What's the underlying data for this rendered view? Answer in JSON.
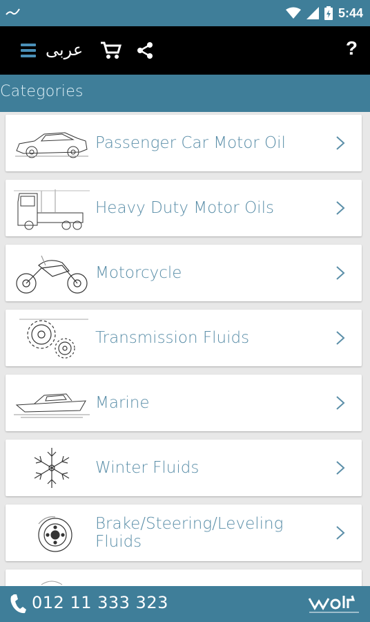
{
  "status_bar": {
    "time": "5:44"
  },
  "toolbar": {
    "language_label": "عربى",
    "help_label": "?"
  },
  "header": {
    "title": "Categories"
  },
  "categories": [
    {
      "label": "Passenger Car Motor Oil",
      "icon": "car-icon"
    },
    {
      "label": "Heavy Duty Motor Oils",
      "icon": "truck-icon"
    },
    {
      "label": "Motorcycle",
      "icon": "motorcycle-icon"
    },
    {
      "label": "Transmission Fluids",
      "icon": "gears-icon"
    },
    {
      "label": "Marine",
      "icon": "boat-icon"
    },
    {
      "label": "Winter Fluids",
      "icon": "snowflake-icon"
    },
    {
      "label": "Brake/Steering/Leveling Fluids",
      "icon": "brake-disc-icon"
    }
  ],
  "footer": {
    "phone": "012 11 333 323",
    "logo": "wolf-logo"
  },
  "colors": {
    "accent": "#3f7e99",
    "label": "#5a8ea8",
    "toolbar": "#000000"
  }
}
